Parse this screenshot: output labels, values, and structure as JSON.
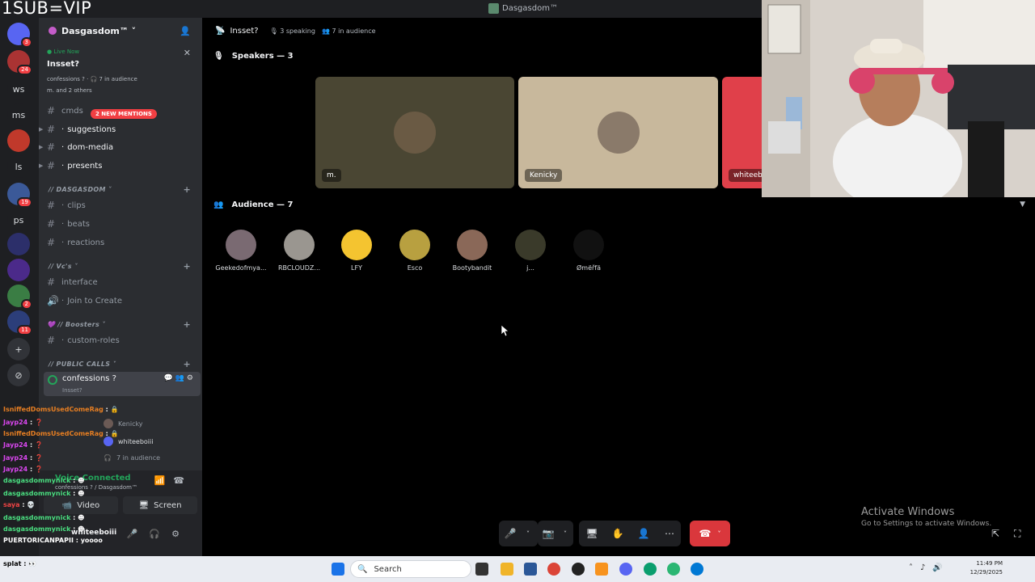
{
  "overlay_tag": "1SUB=VIP",
  "window": {
    "title": "Dasgasdom™"
  },
  "rail": {
    "items": [
      {
        "label": "",
        "badge": "3",
        "color": "#5865f2"
      },
      {
        "label": "",
        "badge": "24",
        "color": "#a33"
      },
      {
        "label": "ws",
        "badge": "",
        "color": "#1e1f22"
      },
      {
        "label": "ms",
        "badge": "",
        "color": "#1e1f22"
      },
      {
        "label": "",
        "badge": "",
        "color": "#c0392b"
      },
      {
        "label": "ls",
        "badge": "",
        "color": "#1e1f22"
      },
      {
        "label": "",
        "badge": "19",
        "color": "#3b5998"
      },
      {
        "label": "ps",
        "badge": "",
        "color": "#1e1f22"
      },
      {
        "label": "",
        "badge": "",
        "color": "#2c2f6a"
      },
      {
        "label": "",
        "badge": "",
        "color": "#4b2a8a"
      },
      {
        "label": "",
        "badge": "2",
        "color": "#3a7d44"
      },
      {
        "label": "",
        "badge": "11",
        "color": "#2c3e7a"
      },
      {
        "label": "+",
        "badge": "",
        "color": "#313338"
      },
      {
        "label": "⊘",
        "badge": "",
        "color": "#313338"
      }
    ]
  },
  "sidebar": {
    "guild_name": "Dasgasdom™ ˅",
    "live": {
      "status": "● Live Now",
      "title": "Insset?",
      "meta": "confessions ? · 🎧 7 in audience",
      "who": "m. and 2 others"
    },
    "mentions": "2 NEW MENTIONS",
    "channels_top": [
      {
        "name": "cmds",
        "unread": false
      },
      {
        "name": "suggestions",
        "unread": true
      },
      {
        "name": "dom-media",
        "unread": true
      },
      {
        "name": "presents",
        "unread": true
      }
    ],
    "cat_dasgasdom": "// DASGASDOM ˅",
    "channels_dasgasdom": [
      "clips",
      "beats",
      "reactions"
    ],
    "cat_vcs": "// Vc's ˅",
    "channels_vcs": [
      "interface",
      "Join to Create"
    ],
    "cat_boosters": "💜 // Boosters ˅",
    "channels_boosters": [
      "custom-roles"
    ],
    "cat_public": "// PUBLIC CALLS ˅",
    "selected_channel": {
      "name": "confessions ?",
      "sub": "Insset?"
    },
    "voice_members": [
      "Kenicky",
      "whiteeboiii",
      "7 in audience"
    ]
  },
  "chat": [
    {
      "user": "IsniffedDomsUsedComeRag",
      "msg": " : 🔒",
      "color": "#e67e22"
    },
    {
      "user": "Jayp24",
      "msg": " : ❓",
      "color": "#d946ef"
    },
    {
      "user": "IsniffedDomsUsedComeRag",
      "msg": " : 🔒",
      "color": "#e67e22"
    },
    {
      "user": "Jayp24",
      "msg": " : ❓",
      "color": "#d946ef"
    },
    {
      "user": "Jayp24",
      "msg": " : ❓",
      "color": "#d946ef"
    },
    {
      "user": "Jayp24",
      "msg": " : ❓",
      "color": "#d946ef"
    },
    {
      "user": "dasgasdommynick",
      "msg": " : ☻",
      "color": "#4ade80"
    },
    {
      "user": "dasgasdommynick",
      "msg": " : ☻",
      "color": "#4ade80"
    },
    {
      "user": "saya",
      "msg": " : 💀",
      "color": "#ef4444"
    },
    {
      "user": "dasgasdommynick",
      "msg": " : ☻",
      "color": "#4ade80"
    },
    {
      "user": "dasgasdommynick",
      "msg": " : ☻",
      "color": "#4ade80"
    },
    {
      "user": "PUERTORICANPAPII",
      "msg": " : yoooo",
      "color": "#ffffff"
    }
  ],
  "voice_panel": {
    "status": "Voice Connected",
    "sub": "confessions ? / Dasgasdom™",
    "video_label": "Video",
    "screen_label": "Screen",
    "user": "whiteeboiii"
  },
  "stage": {
    "channel": "Insset?",
    "speaking": "🎙 3 speaking",
    "audience_count": "👥 7 in audience",
    "speakers_title": "Speakers — 3",
    "audience_title": "Audience — 7",
    "speakers": [
      {
        "name": "m.",
        "bg": "#4a4633",
        "avatar": "#6a5a44"
      },
      {
        "name": "Kenicky",
        "bg": "#c8b89c",
        "avatar": "#8a7a6a"
      },
      {
        "name": "whiteebo",
        "bg": "#e0404a",
        "avatar": "#e0404a"
      }
    ],
    "audience": [
      {
        "name": "Geekedofmya...",
        "color": "#7a6a72"
      },
      {
        "name": "RBCLOUDZ...",
        "color": "#9a9690"
      },
      {
        "name": "LFY",
        "color": "#f4c430"
      },
      {
        "name": "Esco",
        "color": "#b8a040"
      },
      {
        "name": "Bootybandit",
        "color": "#8a6858"
      },
      {
        "name": "j...",
        "color": "#3a3a2a"
      },
      {
        "name": "Ømëřfä",
        "color": "#111111"
      }
    ],
    "activate_title": "Activate Windows",
    "activate_sub": "Go to Settings to activate Windows."
  },
  "taskbar": {
    "search": "Search",
    "time": "11:49 PM",
    "date": "12/29/2025",
    "splat": "splat : 👀"
  }
}
